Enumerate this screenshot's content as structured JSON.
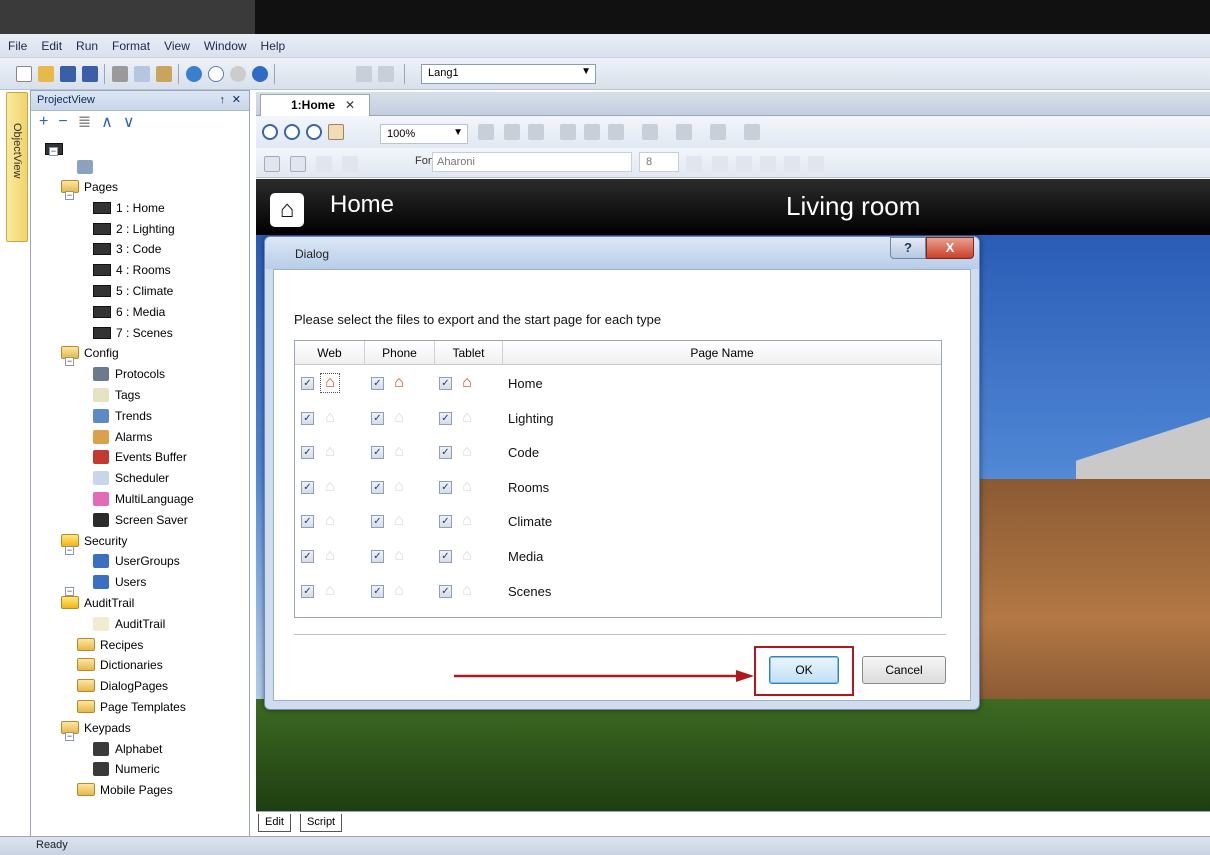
{
  "menu": [
    "File",
    "Edit",
    "Run",
    "Format",
    "View",
    "Window",
    "Help"
  ],
  "toolbar": {
    "language": "Lang1"
  },
  "sidetab": {
    "label": "ObjectView"
  },
  "project_view": {
    "title": "ProjectView",
    "pin": "↑",
    "close": "✕",
    "pages_label": "Pages",
    "pages": [
      "1 : Home",
      "2 : Lighting",
      "3 : Code",
      "4 : Rooms",
      "5 : Climate",
      "6 : Media",
      "7 : Scenes"
    ],
    "config_label": "Config",
    "config": [
      "Protocols",
      "Tags",
      "Trends",
      "Alarms",
      "Events Buffer",
      "Scheduler",
      "MultiLanguage",
      "Screen Saver"
    ],
    "security_label": "Security",
    "security": [
      "UserGroups",
      "Users"
    ],
    "audit_label": "AuditTrail",
    "audit": [
      "AuditTrail"
    ],
    "folders": [
      "Recipes",
      "Dictionaries",
      "DialogPages",
      "Page Templates"
    ],
    "keypads_label": "Keypads",
    "keypads": [
      "Alphabet",
      "Numeric"
    ],
    "mobile_label": "Mobile Pages"
  },
  "editor": {
    "tab_label": "1:Home",
    "tab_close": "✕",
    "zoom": "100%",
    "font_label": "Font",
    "font_value": "Aharoni",
    "font_size": "8"
  },
  "canvas": {
    "title": "Home",
    "room": "Living room"
  },
  "dialog": {
    "title": "Dialog",
    "help": "?",
    "close": "X",
    "instruction": "Please select the files to export and the start page for each type",
    "columns": [
      "Web",
      "Phone",
      "Tablet",
      "Page Name"
    ],
    "rows": [
      {
        "name": "Home",
        "start": true
      },
      {
        "name": "Lighting",
        "start": false
      },
      {
        "name": "Code",
        "start": false
      },
      {
        "name": "Rooms",
        "start": false
      },
      {
        "name": "Climate",
        "start": false
      },
      {
        "name": "Media",
        "start": false
      },
      {
        "name": "Scenes",
        "start": false
      }
    ],
    "ok": "OK",
    "cancel": "Cancel"
  },
  "bottom_tabs": [
    "Edit",
    "Script"
  ],
  "status": "Ready",
  "colors": {
    "annotation": "#b0181b",
    "home_icon": "#c8481c"
  }
}
